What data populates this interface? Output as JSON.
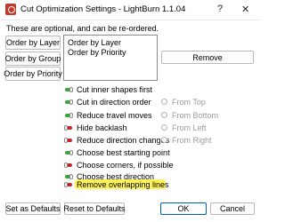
{
  "window": {
    "title": "Cut Optimization Settings - LightBurn 1.1.04",
    "help_glyph": "?",
    "close_glyph": "✕"
  },
  "hint": "These are optional, and can be re-ordered.",
  "order_buttons": [
    "Order by Layer",
    "Order by Group",
    "Order by Priority"
  ],
  "order_list": [
    "Order by Layer",
    "Order by Priority"
  ],
  "remove_label": "Remove",
  "options": [
    {
      "label": "Cut inner shapes first",
      "on": true
    },
    {
      "label": "Cut in direction order",
      "on": true
    },
    {
      "label": "Reduce travel moves",
      "on": true
    },
    {
      "label": "Hide backlash",
      "on": false
    },
    {
      "label": "Reduce direction changes",
      "on": false
    },
    {
      "label": "Choose best starting point",
      "on": true
    },
    {
      "label": "Choose corners, if possible",
      "on": false
    },
    {
      "label": "Choose best direction",
      "on": true
    },
    {
      "label": "Remove overlapping lines",
      "on": false
    }
  ],
  "directions": [
    "From Top",
    "From Bottom",
    "From Left",
    "From Right"
  ],
  "footer": {
    "set_defaults": "Set as Defaults",
    "reset_defaults": "Reset to Defaults",
    "ok": "OK",
    "cancel": "Cancel"
  },
  "colors": {
    "toggle_on": "#3aa63a",
    "toggle_off": "#c62828",
    "highlight": "#fff35a",
    "ok_border": "#005fb8"
  }
}
